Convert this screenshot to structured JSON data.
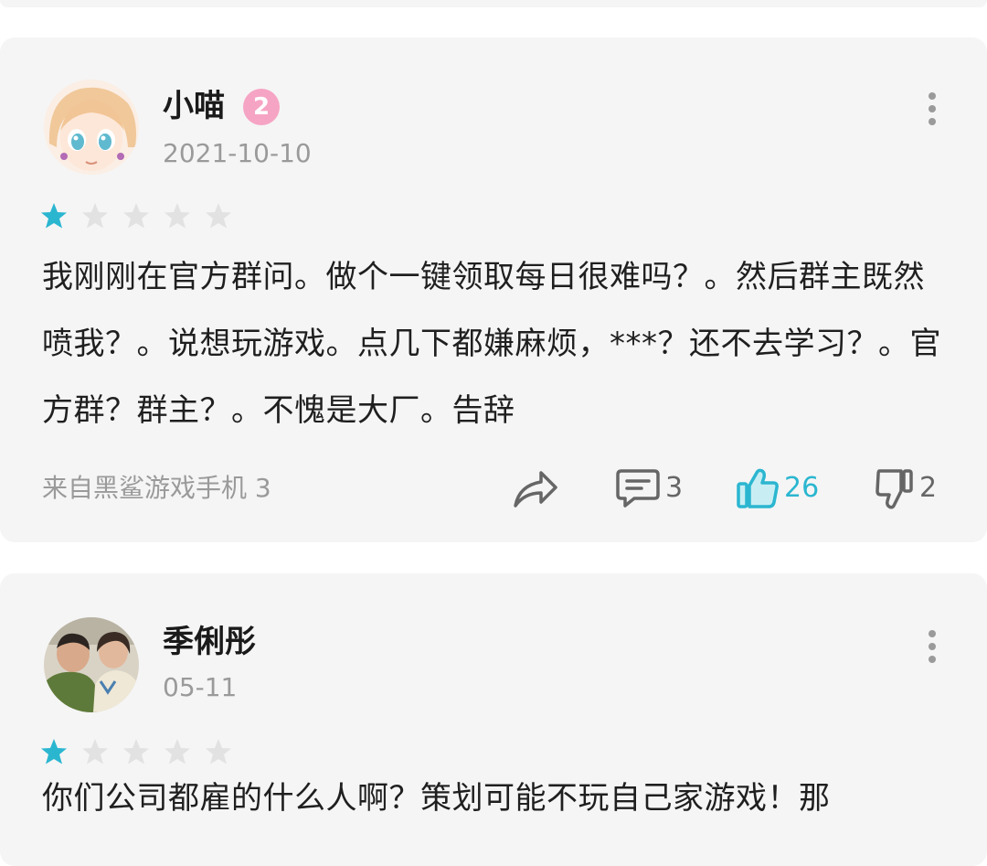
{
  "reviews": [
    {
      "username": "小喵",
      "level": "2",
      "date": "2021-10-10",
      "rating": 1,
      "rating_max": 5,
      "text": "我刚刚在官方群问。做个一键领取每日很难吗？。然后群主既然喷我？。说想玩游戏。点几下都嫌麻烦，***？还不去学习？。官方群？群主？。不愧是大厂。告辞",
      "device": "来自黑鲨游戏手机 3",
      "replies": "3",
      "likes": "26",
      "dislikes": "2",
      "liked": true
    },
    {
      "username": "季俐彤",
      "date": "05-11",
      "rating": 1,
      "rating_max": 5,
      "text": "你们公司都雇的什么人啊？策划可能不玩自己家游戏！那"
    }
  ],
  "colors": {
    "star_filled": "#2bb6d0",
    "star_empty": "#e2e2e2",
    "like_active": "#2bb6d0",
    "level_badge": "#f6a4c4"
  },
  "icons": {
    "more": "more-vertical-icon",
    "share": "share-icon",
    "reply": "comment-icon",
    "like": "thumbs-up-icon",
    "dislike": "thumbs-down-icon"
  }
}
